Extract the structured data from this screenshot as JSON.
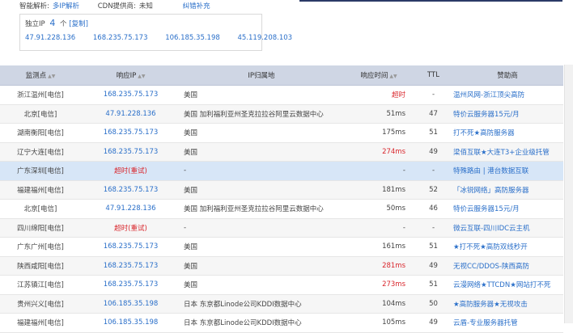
{
  "meta": {
    "smart_label": "智能解析:",
    "smart_value": "多IP解析",
    "cdn_label": "CDN提供商:",
    "cdn_value": "未知",
    "correct_link": "纠错补充"
  },
  "ipbox": {
    "label": "独立IP",
    "count": "4",
    "unit": "个",
    "copy": "[复制]",
    "ips": [
      "47.91.228.136",
      "168.235.75.173",
      "106.185.35.198",
      "45.119.208.103"
    ]
  },
  "table": {
    "headers": [
      "监测点",
      "响应IP",
      "IP归属地",
      "响应时间",
      "TTL",
      "赞助商"
    ],
    "rows": [
      {
        "loc": "浙江温州[电信]",
        "ip": "168.235.75.173",
        "geo": "美国",
        "time": "超时",
        "ttl": "-",
        "sponsor": "温州风网-浙江顶尖高防",
        "timeout": true
      },
      {
        "loc": "北京[电信]",
        "ip": "47.91.228.136",
        "geo": "美国 加利福利亚州圣克拉拉谷阿里云数据中心",
        "time": "51ms",
        "ttl": "47",
        "sponsor": "特价云服务器15元/月"
      },
      {
        "loc": "湖南衡阳[电信]",
        "ip": "168.235.75.173",
        "geo": "美国",
        "time": "175ms",
        "ttl": "51",
        "sponsor": "打不死★高防服务器"
      },
      {
        "loc": "辽宁大连[电信]",
        "ip": "168.235.75.173",
        "geo": "美国",
        "time": "274ms",
        "ttl": "49",
        "sponsor": "梁佰互联★大连T3+企业级托管",
        "slow": true
      },
      {
        "loc": "广东深圳[电信]",
        "ip": "超时(重试)",
        "geo": "-",
        "time": "-",
        "ttl": "-",
        "sponsor": "特殊路由 | 港台数据互联",
        "ipfail": true,
        "hl": true
      },
      {
        "loc": "福建福州[电信]",
        "ip": "168.235.75.173",
        "geo": "美国",
        "time": "181ms",
        "ttl": "52",
        "sponsor": "「冰锐网络」高防服务器"
      },
      {
        "loc": "北京[电信]",
        "ip": "47.91.228.136",
        "geo": "美国 加利福利亚州圣克拉拉谷阿里云数据中心",
        "time": "50ms",
        "ttl": "46",
        "sponsor": "特价云服务器15元/月"
      },
      {
        "loc": "四川绵阳[电信]",
        "ip": "超时(重试)",
        "geo": "-",
        "time": "-",
        "ttl": "-",
        "sponsor": "微云互联-四川IDC云主机",
        "ipfail": true
      },
      {
        "loc": "广东广州[电信]",
        "ip": "168.235.75.173",
        "geo": "美国",
        "time": "161ms",
        "ttl": "51",
        "sponsor": "★打不死★高防双线秒开"
      },
      {
        "loc": "陕西咸阳[电信]",
        "ip": "168.235.75.173",
        "geo": "美国",
        "time": "281ms",
        "ttl": "49",
        "sponsor": "无视CC/DDOS-陕西高防",
        "slow": true
      },
      {
        "loc": "江苏镇江[电信]",
        "ip": "168.235.75.173",
        "geo": "美国",
        "time": "273ms",
        "ttl": "51",
        "sponsor": "云漫网络★TTCDN★网站打不死",
        "slow": true
      },
      {
        "loc": "贵州兴义[电信]",
        "ip": "106.185.35.198",
        "geo": "日本 东京都Linode公司KDDI数据中心",
        "time": "104ms",
        "ttl": "50",
        "sponsor": "★高防服务器★无视攻击"
      },
      {
        "loc": "福建福州[电信]",
        "ip": "106.185.35.198",
        "geo": "日本 东京都Linode公司KDDI数据中心",
        "time": "105ms",
        "ttl": "49",
        "sponsor": "云盾-专业服务器托管"
      }
    ]
  }
}
